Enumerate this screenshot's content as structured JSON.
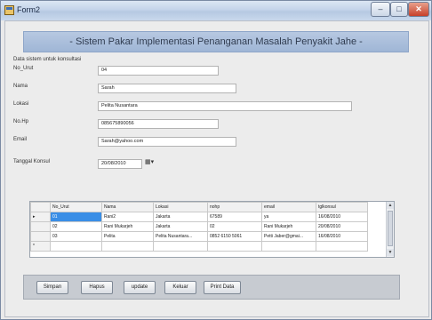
{
  "window": {
    "title": "Form2",
    "min_glyph": "–",
    "max_glyph": "□",
    "close_glyph": "✕"
  },
  "header": {
    "title": "- Sistem Pakar Implementasi Penanganan Masalah Penyakit Jahe -"
  },
  "form": {
    "section_label": "Data sistem untuk konsultasi",
    "no_urut": {
      "label": "No_Urut",
      "value": "04"
    },
    "nama": {
      "label": "Nama",
      "value": "Sarah"
    },
    "lokasi": {
      "label": "Lokasi",
      "value": "Pelita Nusantara"
    },
    "nohp": {
      "label": "No.Hp",
      "value": "085675890056"
    },
    "email": {
      "label": "Email",
      "value": "Sarah@yahoo.com"
    },
    "tanggal": {
      "label": "Tanggal Konsul",
      "value": "20/08/2010",
      "picker_glyph": "▦▾"
    }
  },
  "grid": {
    "columns": [
      "No_Urut",
      "Nama",
      "Lokasi",
      "nohp",
      "email",
      "tglkonsul"
    ],
    "row_indicator": "▸",
    "new_row_indicator": "*",
    "rows": [
      [
        "01",
        "Rani2",
        "Jakarta",
        "67589",
        "ya",
        "16/08/2010"
      ],
      [
        "02",
        "Rani Mukarjeh",
        "Jakarta",
        "02",
        "Rani Mukarjeh",
        "20/08/2010"
      ],
      [
        "03",
        "Pelita",
        "Pelita Nusantara...",
        "0852 6150 5061",
        "Petti Jaber@gmai...",
        "16/08/2010"
      ]
    ],
    "scroll_up": "▲",
    "scroll_down": "▼"
  },
  "buttons": {
    "simpan": "Simpan",
    "hapus": "Hapus",
    "update": "update",
    "keluar": "Keluar",
    "print": "Print Data"
  }
}
